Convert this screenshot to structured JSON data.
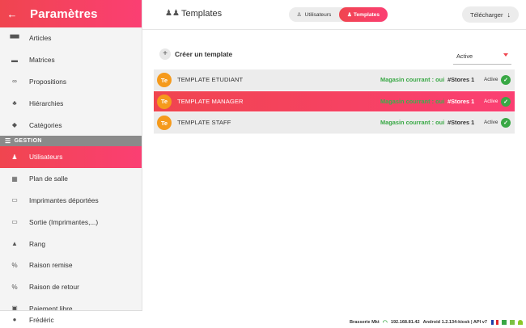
{
  "sidebar": {
    "title": "Paramètres",
    "back_icon": "arrow-left-icon",
    "items_top": [
      {
        "label": "Articles",
        "icon": "boxes-icon",
        "glyph": "▀▀"
      },
      {
        "label": "Matrices",
        "icon": "matrix-icon",
        "glyph": "▬"
      },
      {
        "label": "Propositions",
        "icon": "link-icon",
        "glyph": "∞"
      },
      {
        "label": "Hiérarchies",
        "icon": "hierarchy-icon",
        "glyph": "♣"
      },
      {
        "label": "Catégories",
        "icon": "tag-icon",
        "glyph": "◆"
      }
    ],
    "section_label": "GESTION",
    "items_bottom": [
      {
        "label": "Utilisateurs",
        "icon": "users-icon",
        "glyph": "♟",
        "active": true
      },
      {
        "label": "Plan de salle",
        "icon": "grid-icon",
        "glyph": "▦"
      },
      {
        "label": "Imprimantes déportées",
        "icon": "printer-icon",
        "glyph": "▭"
      },
      {
        "label": "Sortie (Imprimantes,...)",
        "icon": "printer-out-icon",
        "glyph": "▭"
      },
      {
        "label": "Rang",
        "icon": "rank-icon",
        "glyph": "▲"
      },
      {
        "label": "Raison remise",
        "icon": "percent-icon",
        "glyph": "%"
      },
      {
        "label": "Raison de retour",
        "icon": "percent-return-icon",
        "glyph": "%"
      },
      {
        "label": "Paiement libre",
        "icon": "cash-icon",
        "glyph": "▣"
      }
    ],
    "user": {
      "label": "Frédéric",
      "icon": "user-icon"
    }
  },
  "topbar": {
    "title": "Templates",
    "title_icon": "users-group-icon",
    "toggle_users": "Utilisateurs",
    "toggle_templates": "Templates",
    "download": "Télécharger",
    "download_icon": "arrow-down-icon"
  },
  "main": {
    "create_label": "Créer un template",
    "filter_value": "Active",
    "templates": [
      {
        "avatar": "Te",
        "name": "TEMPLATE ETUDIANT",
        "store": "Magasin courrant : oui",
        "stores": "#Stores 1",
        "status": "Active",
        "selected": false
      },
      {
        "avatar": "Te",
        "name": "TEMPLATE MANAGER",
        "store": "Magasin courrant : oui",
        "stores": "#Stores 1",
        "status": "Active",
        "selected": true
      },
      {
        "avatar": "Te",
        "name": "TEMPLATE STAFF",
        "store": "Magasin courrant : oui",
        "stores": "#Stores 1",
        "status": "Active",
        "selected": false
      }
    ]
  },
  "statusbar": {
    "shop": "Brasserie Mkt",
    "ip": "192.168.81.42",
    "version": "Android 1.2.134-kiosk | API v7"
  },
  "colors": {
    "accent_start": "#f0454f",
    "accent_end": "#fb3f73",
    "success": "#39a845",
    "avatar": "#f59a1c"
  }
}
